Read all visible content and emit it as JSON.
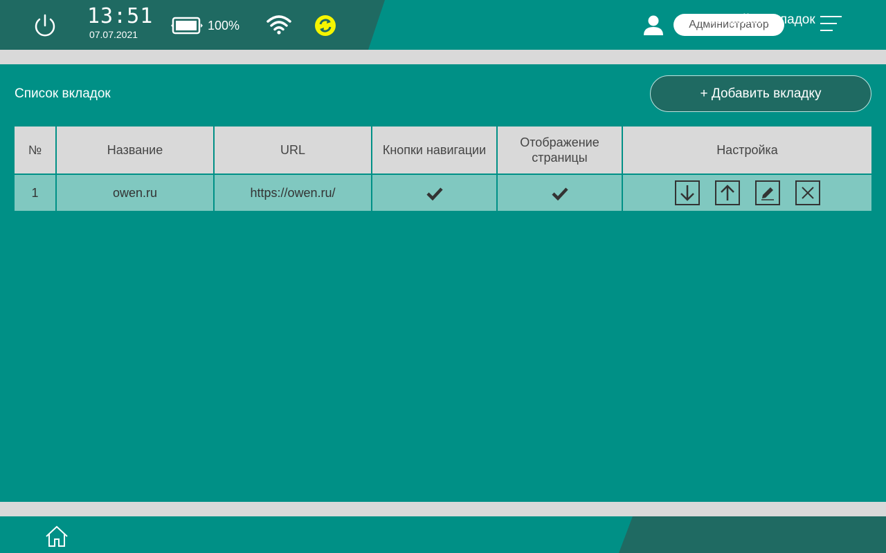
{
  "status_bar": {
    "time": "13:51",
    "date": "07.07.2021",
    "battery_percent": "100%",
    "user_name": "Администратор",
    "icons": [
      "power-icon",
      "battery-icon",
      "wifi-icon",
      "sync-icon",
      "user-icon",
      "menu-icon"
    ],
    "sync_color": "#f5f500"
  },
  "page": {
    "section_title": "Список вкладок",
    "add_button": "+ Добавить вкладку"
  },
  "table": {
    "headers": [
      "№",
      "Название",
      "URL",
      "Кнопки навигации",
      "Отображение страницы",
      "Настройка"
    ],
    "rows": [
      {
        "num": "1",
        "name": "owen.ru",
        "url": "https://owen.ru/",
        "nav_buttons": true,
        "page_display": true,
        "actions": [
          "move-down",
          "move-up",
          "edit",
          "delete"
        ]
      }
    ]
  },
  "footer": {
    "title": "Настройки вкладок",
    "icons": [
      "home-icon"
    ]
  },
  "colors": {
    "background": "#009086",
    "dark_panel": "#1f6a62",
    "separator": "#d9d9d9",
    "header_row": "#d9d9d9",
    "data_row": "#80c8c0"
  }
}
